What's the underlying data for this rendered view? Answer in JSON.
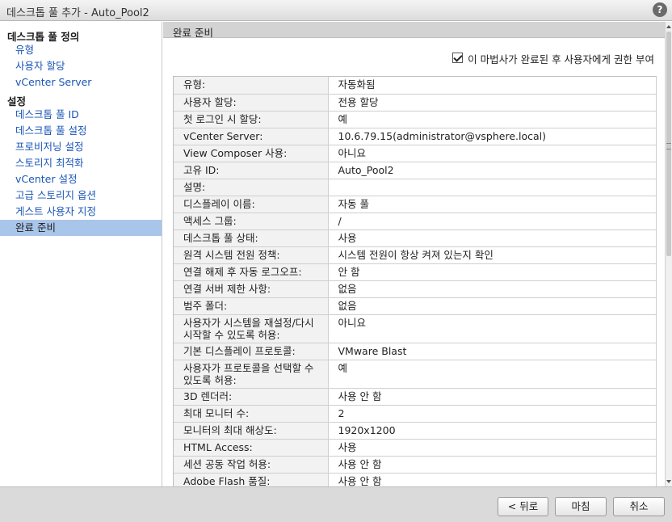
{
  "window": {
    "title": "데스크톱 풀 추가 - Auto_Pool2",
    "help_label": "?"
  },
  "sidebar": {
    "sections": [
      {
        "heading": "데스크톱 풀 정의",
        "items": [
          "유형",
          "사용자 할당",
          "vCenter Server"
        ]
      },
      {
        "heading": "설정",
        "items": [
          "데스크톱 풀 ID",
          "데스크톱 풀 설정",
          "프로비저닝 설정",
          "스토리지 최적화",
          "vCenter 설정",
          "고급 스토리지 옵션",
          "게스트 사용자 지정",
          "완료 준비"
        ]
      }
    ],
    "selected_item": "완료 준비"
  },
  "main": {
    "section_title": "완료 준비",
    "grant_checkbox_label": "이 마법사가 완료된 후 사용자에게 권한 부여",
    "grant_checked": true,
    "summary": [
      [
        "유형:",
        "자동화됨"
      ],
      [
        "사용자 할당:",
        "전용 할당"
      ],
      [
        "첫 로그인 시 할당:",
        "예"
      ],
      [
        "vCenter Server:",
        "10.6.79.15(administrator@vsphere.local)"
      ],
      [
        "View Composer 사용:",
        "아니요"
      ],
      [
        "고유 ID:",
        "Auto_Pool2"
      ],
      [
        "설명:",
        ""
      ],
      [
        "디스플레이 이름:",
        "자동 풀"
      ],
      [
        "액세스 그룹:",
        "/"
      ],
      [
        "데스크톱 풀 상태:",
        "사용"
      ],
      [
        "원격 시스템 전원 정책:",
        "시스템 전원이 항상 켜져 있는지 확인"
      ],
      [
        "연결 해제 후 자동 로그오프:",
        "안 함"
      ],
      [
        "연결 서버 제한 사항:",
        "없음"
      ],
      [
        "범주 폴더:",
        "없음"
      ],
      [
        "사용자가 시스템을 재설정/다시 시작할 수 있도록 허용:",
        "아니요"
      ],
      [
        "기본 디스플레이 프로토콜:",
        "VMware Blast"
      ],
      [
        "사용자가 프로토콜을 선택할 수 있도록 허용:",
        "예"
      ],
      [
        "3D 렌더러:",
        "사용 안 함"
      ],
      [
        "최대 모니터 수:",
        "2"
      ],
      [
        "모니터의 최대 해상도:",
        "1920x1200"
      ],
      [
        "HTML Access:",
        "사용"
      ],
      [
        "세션 공동 작업 허용:",
        "사용 안 함"
      ],
      [
        "Adobe Flash 품질:",
        "사용 안 함"
      ]
    ]
  },
  "footer": {
    "back_label": "< 뒤로",
    "finish_label": "마침",
    "cancel_label": "취소"
  }
}
